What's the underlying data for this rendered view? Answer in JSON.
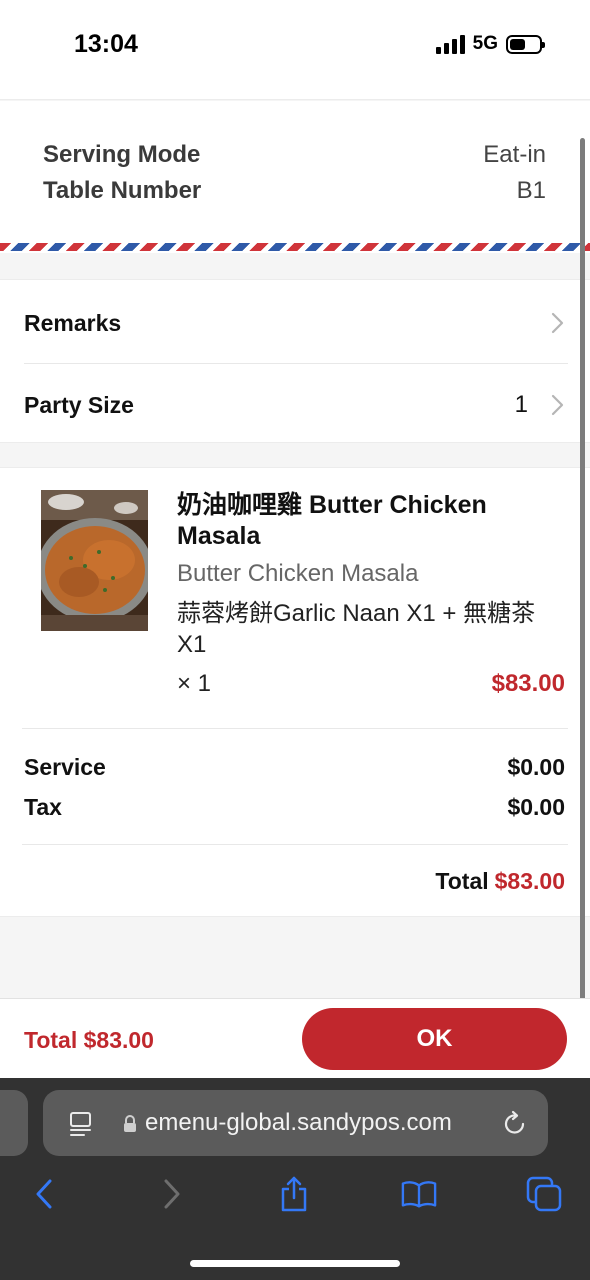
{
  "status_bar": {
    "time": "13:04",
    "network": "5G",
    "icons": [
      "signal-icon",
      "battery-icon"
    ]
  },
  "serving": {
    "mode_label": "Serving Mode",
    "mode_value": "Eat-in",
    "table_label": "Table Number",
    "table_value": "B1"
  },
  "options": {
    "remarks_label": "Remarks",
    "party_size_label": "Party Size",
    "party_size_value": "1"
  },
  "order": {
    "item": {
      "name": "奶油咖哩雞 Butter Chicken Masala",
      "subtitle": "Butter Chicken Masala",
      "modifiers": "蒜蓉烤餅Garlic Naan X1 + 無糖茶 X1",
      "quantity": "× 1",
      "price": "$83.00",
      "image_icon": "food-photo"
    },
    "service_label": "Service",
    "service_value": "$0.00",
    "tax_label": "Tax",
    "tax_value": "$0.00",
    "total_label": "Total",
    "total_value": "$83.00"
  },
  "action_bar": {
    "total_text": "Total $83.00",
    "ok_label": "OK"
  },
  "browser": {
    "url": "emenu-global.sandypos.com",
    "icons": [
      "page-menu-icon",
      "lock-icon",
      "reload-icon",
      "back-icon",
      "forward-icon",
      "share-icon",
      "bookmarks-icon",
      "tabs-icon"
    ]
  },
  "colors": {
    "accent_red": "#c1272d",
    "price_red": "#c0282d",
    "airmail_blue": "#2f5aa8",
    "browser_blue": "#3478f6"
  }
}
